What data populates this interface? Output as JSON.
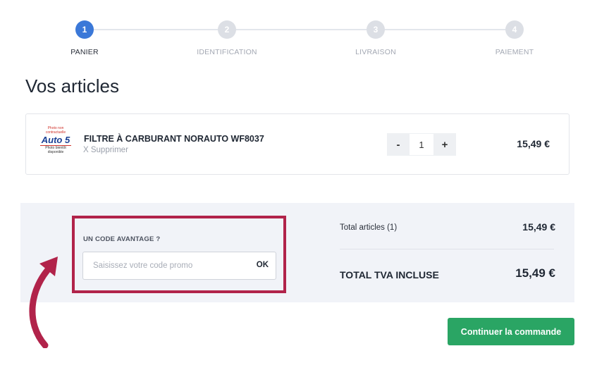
{
  "stepper": {
    "steps": [
      {
        "number": "1",
        "label": "PANIER"
      },
      {
        "number": "2",
        "label": "IDENTIFICATION"
      },
      {
        "number": "3",
        "label": "LIVRAISON"
      },
      {
        "number": "4",
        "label": "PAIEMENT"
      }
    ],
    "active_step": 1
  },
  "page": {
    "title": "Vos articles"
  },
  "cart": {
    "item": {
      "logo": {
        "top_text": "Photo non contractuelle",
        "brand": "Auto 5",
        "bottom_text": "Photo bientôt disponible"
      },
      "name": "FILTRE À CARBURANT NORAUTO WF8037",
      "remove_label": "X Supprimer",
      "qty_minus": "-",
      "quantity": "1",
      "qty_plus": "+",
      "price": "15,49 €"
    }
  },
  "promo": {
    "label": "UN CODE AVANTAGE ?",
    "placeholder": "Saisissez votre code promo",
    "value": "",
    "submit_label": "OK"
  },
  "summary": {
    "articles_label": "Total articles (1)",
    "articles_value": "15,49 €",
    "total_label": "TOTAL TVA INCLUSE",
    "total_value": "15,49 €"
  },
  "actions": {
    "continue_label": "Continuer la commande"
  },
  "colors": {
    "accent_blue": "#3b78d8",
    "cta_green": "#2aa564",
    "highlight_red": "#b1234a",
    "panel_bg": "#f1f3f8"
  }
}
